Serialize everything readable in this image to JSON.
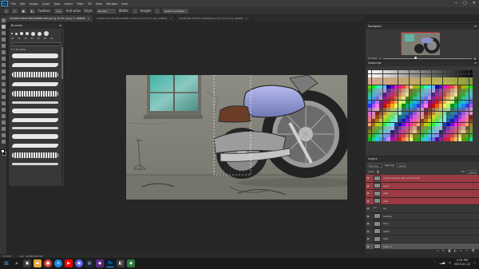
{
  "menubar": {
    "items": [
      "File",
      "Edit",
      "Image",
      "Layer",
      "Type",
      "Select",
      "Filter",
      "3D",
      "View",
      "Window",
      "Help"
    ]
  },
  "window_controls": [
    "─",
    "▢",
    "✕"
  ],
  "options": {
    "feather_label": "Feather:",
    "feather_value": "0 px",
    "antialias_label": "Anti-alias",
    "style_label": "Style:",
    "style_value": "Normal",
    "width_label": "Width:",
    "height_label": "Height:",
    "select_mask_label": "Select and Mask..."
  },
  "tabs": [
    {
      "label": "CHAINS GRACE WALLPAPER 006.psd @ 33.3% (Layer 1, RGB/8)",
      "active": true
    },
    {
      "label": "CHAIN GOTTIS WALLPAPER COUCH.psd @ 50% (bg, RGB/8)",
      "active": false
    },
    {
      "label": "LOCATION TATTOO GARAGE.psd @ 33.3% (bg, RGB/8)",
      "active": false
    }
  ],
  "brushes": {
    "title": "Brushes",
    "sizes": [
      "30",
      "30",
      "25",
      "25",
      "30",
      "25",
      "25"
    ],
    "search_placeholder": "",
    "group_label": "Brushes"
  },
  "navigator": {
    "title": "Navigator",
    "zoom": "33.33%"
  },
  "swatches": {
    "title": "Swatches"
  },
  "layers": {
    "title": "Layers",
    "blend_mode": "Normal",
    "opacity_label": "Opacity:",
    "opacity_value": "100%",
    "lock_label": "Lock:",
    "fill_label": "Fill:",
    "fill_value": "100%",
    "items": [
      {
        "name": "upload guides wall (additional)",
        "style": "red",
        "group": false
      },
      {
        "name": "layer",
        "style": "red",
        "group": false
      },
      {
        "name": "wall",
        "style": "red",
        "group": false
      },
      {
        "name": "wall",
        "style": "red",
        "group": false
      },
      {
        "name": "bg",
        "style": "normal",
        "group": true
      },
      {
        "name": "texture",
        "style": "normal",
        "group": false
      },
      {
        "name": "floor",
        "style": "normal",
        "group": false
      },
      {
        "name": "wall2",
        "style": "normal",
        "group": false
      },
      {
        "name": "wall",
        "style": "normal",
        "group": false
      },
      {
        "name": "Layer 1",
        "style": "selected",
        "group": false
      },
      {
        "name": "wall3",
        "style": "normal",
        "group": false
      }
    ]
  },
  "status": {
    "zoom": "33.33%",
    "doc": "Doc: 48.8M/364.5M"
  },
  "taskbar": {
    "time": "2:01 PM",
    "date": "2023-01-22"
  },
  "colors": {
    "accent": "#31a8ff",
    "layer_red": "#9b3a44",
    "wall": "#8a8a80",
    "floor": "#76766c",
    "bike_tank": "#8a90c8"
  }
}
